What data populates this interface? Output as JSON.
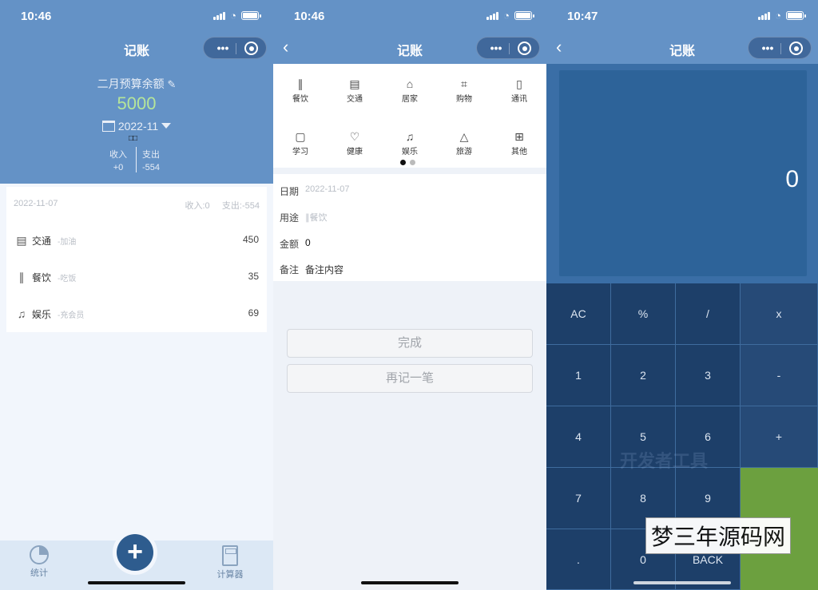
{
  "panel1": {
    "status_time": "10:46",
    "title": "记账",
    "budget_label": "二月预算余额",
    "budget_value": "5000",
    "month": "2022-11",
    "boxes": "□□",
    "income_label": "收入",
    "income_value": "+0",
    "expense_label": "支出",
    "expense_value": "-554",
    "date": "2022-11-07",
    "day_income": "收入:0",
    "day_expense": "支出:-554",
    "records": [
      {
        "icon": "bus-icon",
        "category": "交通",
        "note": "-加油",
        "amount": "450"
      },
      {
        "icon": "fork-knife-icon",
        "category": "餐饮",
        "note": "-吃饭",
        "amount": "35"
      },
      {
        "icon": "music-icon",
        "category": "娱乐",
        "note": "-充会员",
        "amount": "69"
      }
    ],
    "tab_stats": "统计",
    "tab_calc": "计算器",
    "add_symbol": "+"
  },
  "panel2": {
    "status_time": "10:46",
    "title": "记账",
    "back": "‹",
    "categories": [
      "餐饮",
      "交通",
      "居家",
      "购物",
      "通讯",
      "学习",
      "健康",
      "娱乐",
      "旅游",
      "其他"
    ],
    "date_label": "日期",
    "date_value": "2022-11-07",
    "use_label": "用途",
    "use_value": "餐饮",
    "amount_label": "金额",
    "amount_value": "0",
    "remark_label": "备注",
    "remark_placeholder": "备注内容",
    "done_button": "完成",
    "again_button": "再记一笔",
    "page_dots_active": 0
  },
  "panel3": {
    "status_time": "10:47",
    "title": "记账",
    "back": "‹",
    "display": "0",
    "keys": [
      [
        "AC",
        "%",
        "/",
        "x"
      ],
      [
        "1",
        "2",
        "3",
        "-"
      ],
      [
        "4",
        "5",
        "6",
        "+"
      ],
      [
        "7",
        "8",
        "9",
        ""
      ],
      [
        ".",
        "0",
        "BACK",
        ""
      ]
    ],
    "watermark": "梦三年源码网",
    "faint_text": "开发者工具"
  },
  "colors": {
    "header_blue": "#6492c6",
    "budget_green": "#b5e59a",
    "calc_dark": "#1d3f69",
    "equals_green": "#6ca03f"
  }
}
